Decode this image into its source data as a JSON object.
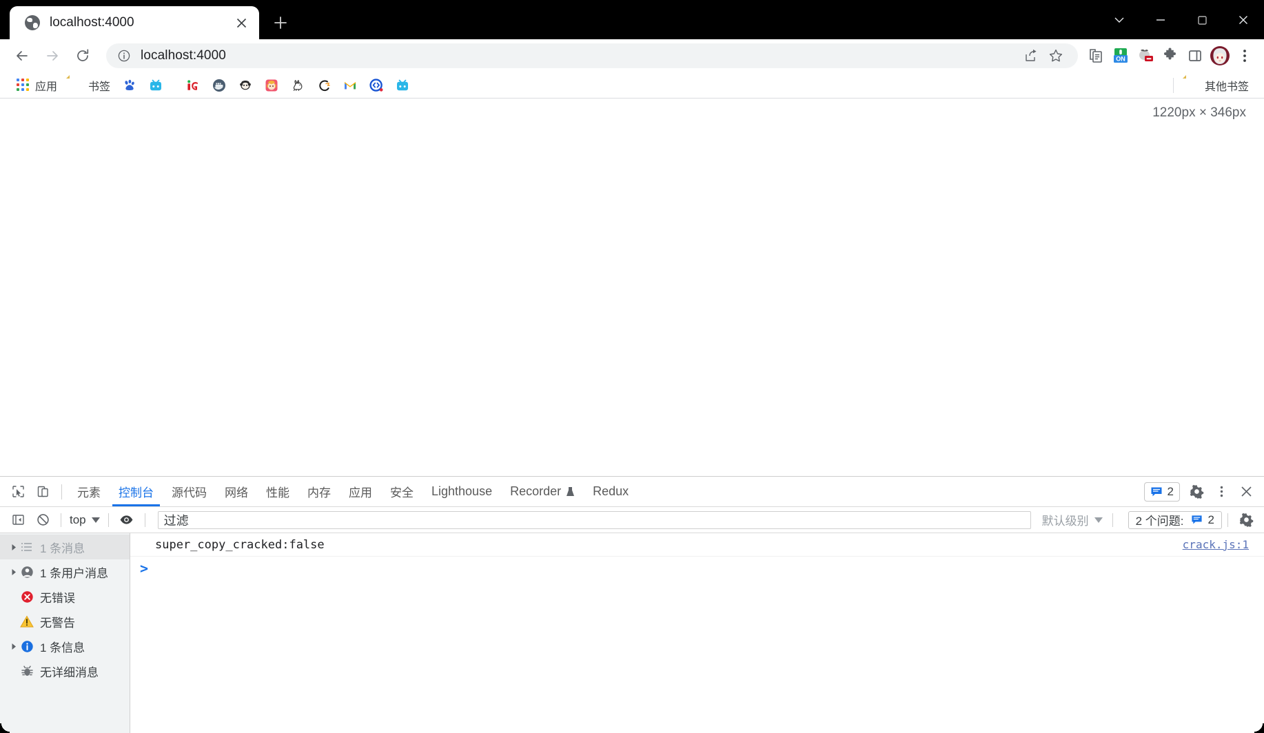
{
  "window": {
    "controls": {
      "tab_search": "tab-search-chevron",
      "minimize": "minimize",
      "maximize": "maximize",
      "close": "close"
    }
  },
  "tab": {
    "title": "localhost:4000",
    "favicon": "globe-icon",
    "close_label": "×",
    "new_tab_label": "+"
  },
  "toolbar": {
    "back": "back-arrow",
    "forward": "forward-arrow",
    "reload": "reload-icon",
    "omnibox": {
      "info_icon": "info-circle-icon",
      "host": "localhost",
      "port": ":4000",
      "full": "localhost:4000",
      "share_icon": "share-icon",
      "bookmark_icon": "star-icon"
    },
    "extensions": [
      {
        "name": "reading-list-icon"
      },
      {
        "name": "on-toggle-extension-icon",
        "label": "ON"
      },
      {
        "name": "tomato-extension-icon"
      },
      {
        "name": "puzzle-extensions-icon"
      },
      {
        "name": "side-panel-icon"
      },
      {
        "name": "profile-avatar"
      },
      {
        "name": "chrome-menu-icon"
      }
    ]
  },
  "bookmarks": {
    "apps_label": "应用",
    "bookmarks_label": "书签",
    "other_label": "其他书签",
    "items": [
      {
        "name": "apps-grid",
        "label": "应用",
        "type": "grid"
      },
      {
        "name": "bookmarks-folder",
        "label": "书签",
        "type": "folder"
      },
      {
        "name": "baidu-bookmark",
        "label": "",
        "type": "icon"
      },
      {
        "name": "bilibili-bookmark",
        "label": "",
        "type": "icon"
      },
      {
        "name": "ig-bookmark",
        "label": "",
        "type": "icon"
      },
      {
        "name": "docker-bookmark",
        "label": "",
        "type": "icon"
      },
      {
        "name": "monkey-bookmark",
        "label": "",
        "type": "icon"
      },
      {
        "name": "anime-bookmark",
        "label": "",
        "type": "icon"
      },
      {
        "name": "rabbitmq-bookmark",
        "label": "",
        "type": "icon"
      },
      {
        "name": "csdn-bookmark",
        "label": "",
        "type": "icon"
      },
      {
        "name": "gmail-bookmark",
        "label": "",
        "type": "icon"
      },
      {
        "name": "juejin-bookmark",
        "label": "",
        "type": "icon"
      },
      {
        "name": "bilibili2-bookmark",
        "label": "",
        "type": "icon"
      }
    ]
  },
  "page": {
    "viewport_badge": "1220px × 346px"
  },
  "devtools": {
    "tabs": [
      {
        "label": "元素",
        "active": false,
        "latin": false
      },
      {
        "label": "控制台",
        "active": true,
        "latin": false
      },
      {
        "label": "源代码",
        "active": false,
        "latin": false
      },
      {
        "label": "网络",
        "active": false,
        "latin": false
      },
      {
        "label": "性能",
        "active": false,
        "latin": false
      },
      {
        "label": "内存",
        "active": false,
        "latin": false
      },
      {
        "label": "应用",
        "active": false,
        "latin": false
      },
      {
        "label": "安全",
        "active": false,
        "latin": false
      },
      {
        "label": "Lighthouse",
        "active": false,
        "latin": true
      },
      {
        "label": "Recorder",
        "active": false,
        "latin": true
      },
      {
        "label": "Redux",
        "active": false,
        "latin": true
      }
    ],
    "inspect_icon": "inspect-element-icon",
    "device_icon": "device-toolbar-icon",
    "messages_badge_count": "2",
    "settings_icon": "gear-icon",
    "more_icon": "more-vertical-icon",
    "close_icon": "close-icon",
    "console": {
      "sidebar_toggle_icon": "console-sidebar-toggle-icon",
      "clear_icon": "clear-console-icon",
      "context": "top",
      "eye_icon": "live-expression-eye-icon",
      "filter_placeholder": "过滤",
      "filter_value": "",
      "levels_label": "默认级别",
      "issues_label": "2 个问题:",
      "issues_count": "2",
      "settings_icon": "console-settings-gear-icon",
      "sidebar": [
        {
          "label": "1 条消息",
          "icon": "list-icon",
          "expandable": true,
          "selected": true,
          "muted": true
        },
        {
          "label": "1 条用户消息",
          "icon": "user-icon",
          "expandable": true,
          "selected": false,
          "muted": false
        },
        {
          "label": "无错误",
          "icon": "error-icon",
          "expandable": false,
          "selected": false,
          "muted": false
        },
        {
          "label": "无警告",
          "icon": "warning-icon",
          "expandable": false,
          "selected": false,
          "muted": false
        },
        {
          "label": "1 条信息",
          "icon": "info-icon",
          "expandable": true,
          "selected": false,
          "muted": false
        },
        {
          "label": "无详细消息",
          "icon": "verbose-bug-icon",
          "expandable": false,
          "selected": false,
          "muted": false
        }
      ],
      "logs": [
        {
          "message": "super_copy_cracked:false",
          "source": "crack.js:1"
        }
      ],
      "prompt": ">"
    }
  },
  "colors": {
    "accent": "#1a73e8",
    "titlebar": "#000000",
    "toolbar_bg": "#ffffff",
    "omnibox_bg": "#f1f3f4",
    "sidebar_bg": "#f1f3f4",
    "error": "#d93025",
    "warning": "#f9ab00",
    "info": "#1a73e8"
  }
}
